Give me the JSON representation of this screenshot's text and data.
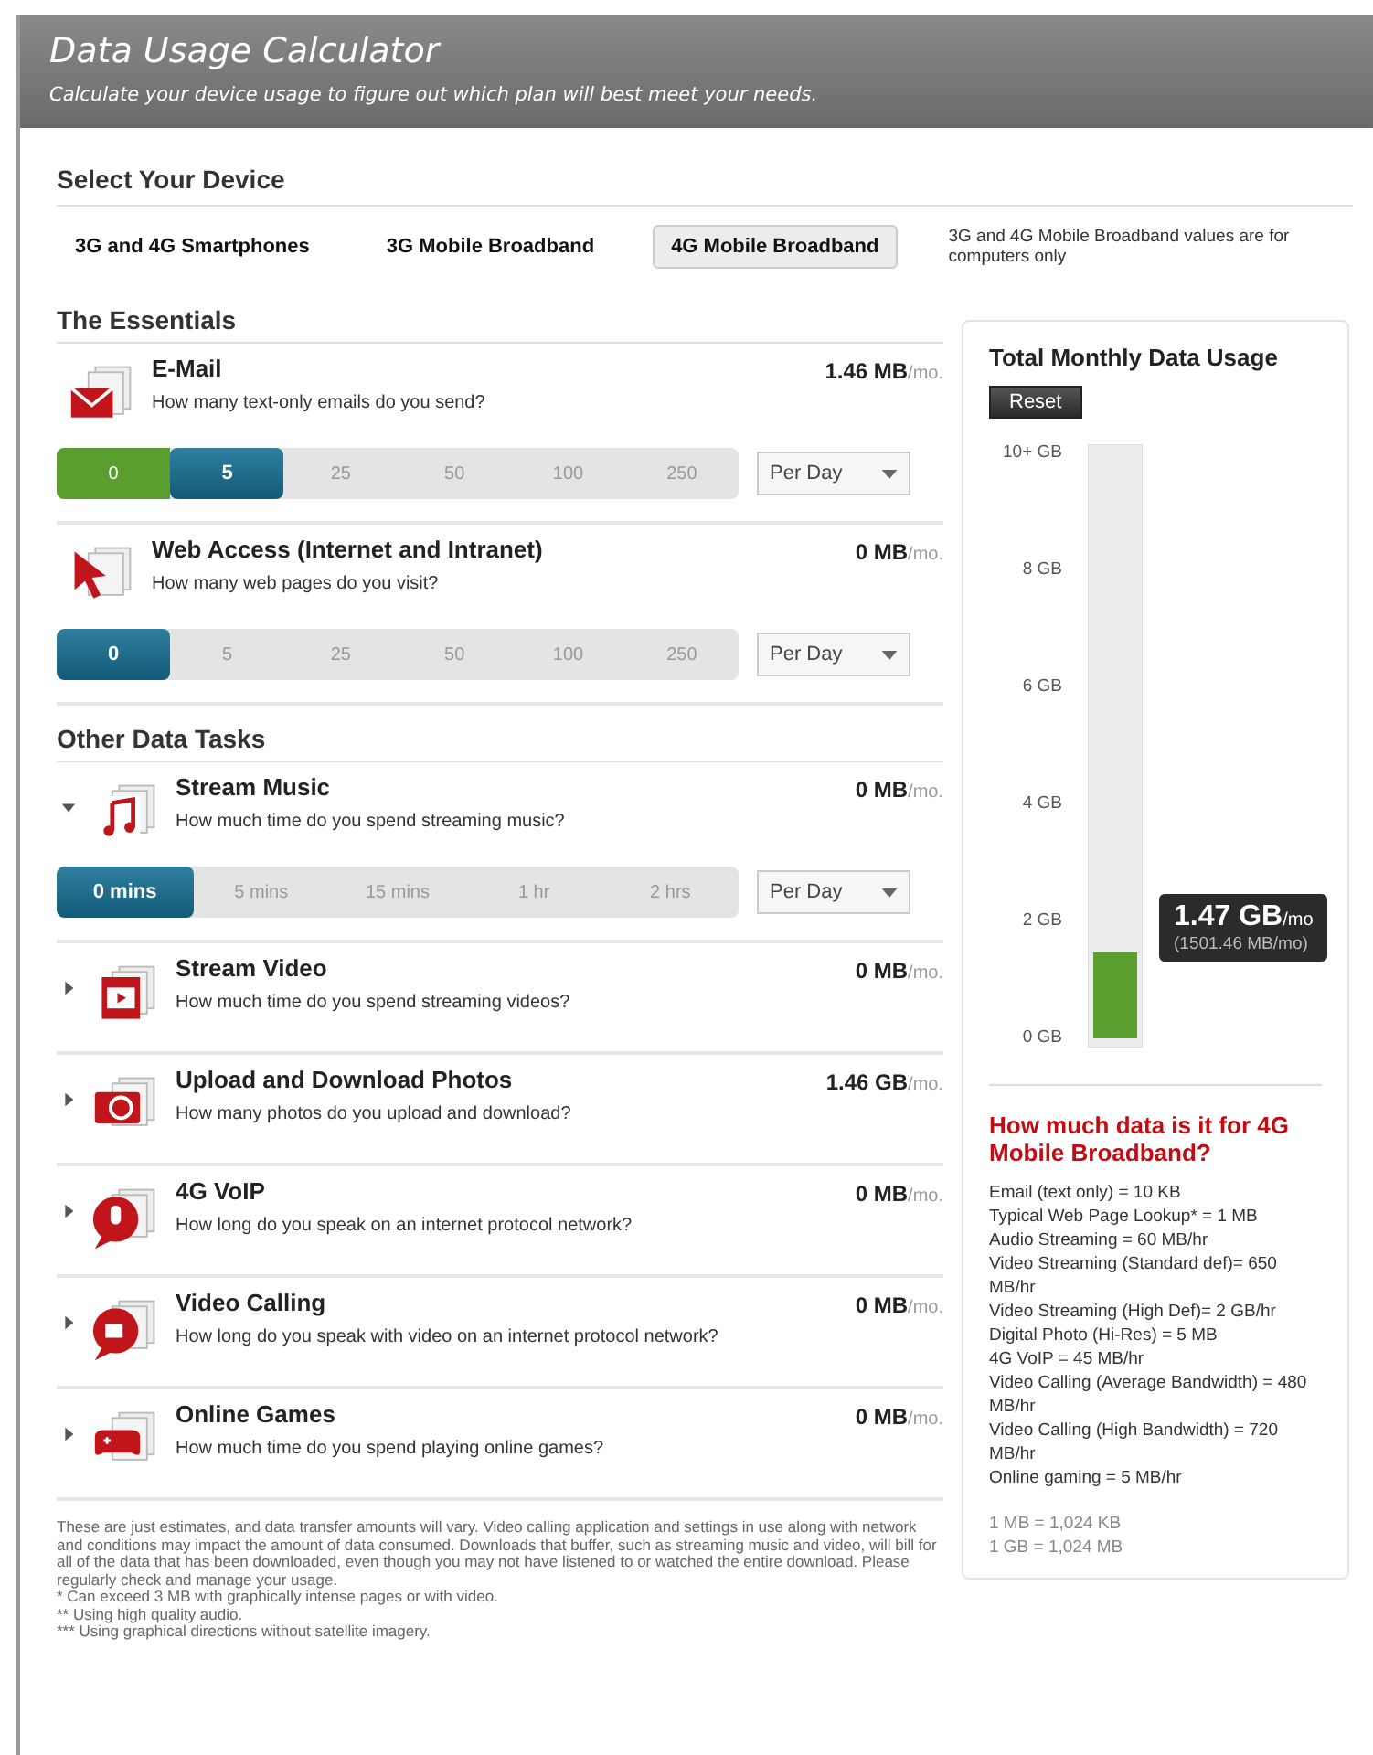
{
  "header": {
    "title": "Data Usage Calculator",
    "subtitle": "Calculate your device usage to figure out which plan will best meet your needs."
  },
  "device_section": {
    "title": "Select Your Device",
    "tabs": [
      {
        "label": "3G and 4G Smartphones",
        "selected": false
      },
      {
        "label": "3G Mobile Broadband",
        "selected": false
      },
      {
        "label": "4G Mobile Broadband",
        "selected": true
      }
    ],
    "note": "3G and 4G Mobile Broadband values are for computers only"
  },
  "sections": [
    {
      "title": "The Essentials",
      "tasks": [
        {
          "kind": "email",
          "title": "E-Mail",
          "question": "How many text-only emails do you send?",
          "amount": "1.46 MB",
          "unit": "/mo.",
          "options": [
            {
              "label": "0",
              "selected": false
            },
            {
              "label": "5",
              "selected": true
            },
            {
              "label": "25",
              "selected": false
            },
            {
              "label": "50",
              "selected": false
            },
            {
              "label": "100",
              "selected": false
            },
            {
              "label": "250",
              "selected": false
            }
          ],
          "period": "Per Day"
        },
        {
          "kind": "web",
          "title": "Web Access (Internet and Intranet)",
          "question": "How many web pages do you visit?",
          "amount": "0 MB",
          "unit": "/mo.",
          "options": [
            {
              "label": "0",
              "selected": true
            },
            {
              "label": "5",
              "selected": false
            },
            {
              "label": "25",
              "selected": false
            },
            {
              "label": "50",
              "selected": false
            },
            {
              "label": "100",
              "selected": false
            },
            {
              "label": "250",
              "selected": false
            }
          ],
          "period": "Per Day"
        }
      ]
    },
    {
      "title": "Other Data Tasks",
      "tasks": [
        {
          "kind": "music",
          "expanded": true,
          "title": "Stream Music",
          "question": "How much time do you spend streaming music?",
          "amount": "0 MB",
          "unit": "/mo.",
          "options": [
            {
              "label": "0 mins",
              "selected": true
            },
            {
              "label": "5 mins",
              "selected": false
            },
            {
              "label": "15 mins",
              "selected": false
            },
            {
              "label": "1 hr",
              "selected": false
            },
            {
              "label": "2 hrs",
              "selected": false
            }
          ],
          "period": "Per Day"
        },
        {
          "kind": "video",
          "expanded": false,
          "title": "Stream Video",
          "question": "How much time do you spend streaming videos?",
          "amount": "0 MB",
          "unit": "/mo."
        },
        {
          "kind": "photo",
          "expanded": false,
          "title": "Upload and Download Photos",
          "question": "How many photos do you upload and download?",
          "amount": "1.46 GB",
          "unit": "/mo."
        },
        {
          "kind": "voip",
          "expanded": false,
          "title": "4G VoIP",
          "question": "How long do you speak on an internet protocol network?",
          "amount": "0 MB",
          "unit": "/mo."
        },
        {
          "kind": "videocall",
          "expanded": false,
          "title": "Video Calling",
          "question": "How long do you speak with video on an internet protocol network?",
          "amount": "0 MB",
          "unit": "/mo."
        },
        {
          "kind": "games",
          "expanded": false,
          "title": "Online Games",
          "question": "How much time do you spend playing online games?",
          "amount": "0 MB",
          "unit": "/mo."
        }
      ]
    }
  ],
  "disclaimer": "These are just estimates, and data transfer amounts will vary. Video calling application and settings in use along with network and conditions may impact the amount of data consumed. Downloads that buffer, such as streaming music and video, will bill for all of the data that has been downloaded, even though you may not have listened to or watched the entire download. Please regularly check and manage your usage.",
  "footnotes": [
    "* Can exceed 3 MB with graphically intense pages or with video.",
    "** Using high quality audio.",
    "*** Using graphical directions without satellite imagery."
  ],
  "usage_panel": {
    "title": "Total Monthly Data Usage",
    "reset_button": "Reset",
    "chart_data": {
      "type": "bar",
      "series": [
        {
          "color": "#5b9e30",
          "values": [
            1.47
          ]
        }
      ],
      "ylim": [
        0,
        10
      ],
      "yticks": [
        {
          "value": 0,
          "label": "0 GB"
        },
        {
          "value": 2,
          "label": "2 GB"
        },
        {
          "value": 4,
          "label": "4 GB"
        },
        {
          "value": 6,
          "label": "6 GB"
        },
        {
          "value": 8,
          "label": "8 GB"
        },
        {
          "value": 10,
          "label": "10+ GB"
        }
      ]
    },
    "total": "1.47 GB",
    "total_unit": "/mo",
    "total_mb": "(1501.46 MB/mo)",
    "reference_title": "How much data is it for 4G Mobile Broadband?",
    "reference": [
      "Email (text only) = 10 KB",
      "Typical Web Page Lookup* = 1 MB",
      "Audio Streaming = 60 MB/hr",
      "Video Streaming (Standard def)= 650 MB/hr",
      "Video Streaming (High Def)= 2 GB/hr",
      "Digital Photo (Hi-Res) = 5 MB",
      "4G VoIP = 45 MB/hr",
      "Video Calling (Average Bandwidth) = 480 MB/hr",
      "Video Calling (High Bandwidth) = 720 MB/hr",
      "Online gaming = 5 MB/hr"
    ],
    "conversions": [
      "1 MB = 1,024 KB",
      "1 GB = 1,024 MB"
    ]
  }
}
